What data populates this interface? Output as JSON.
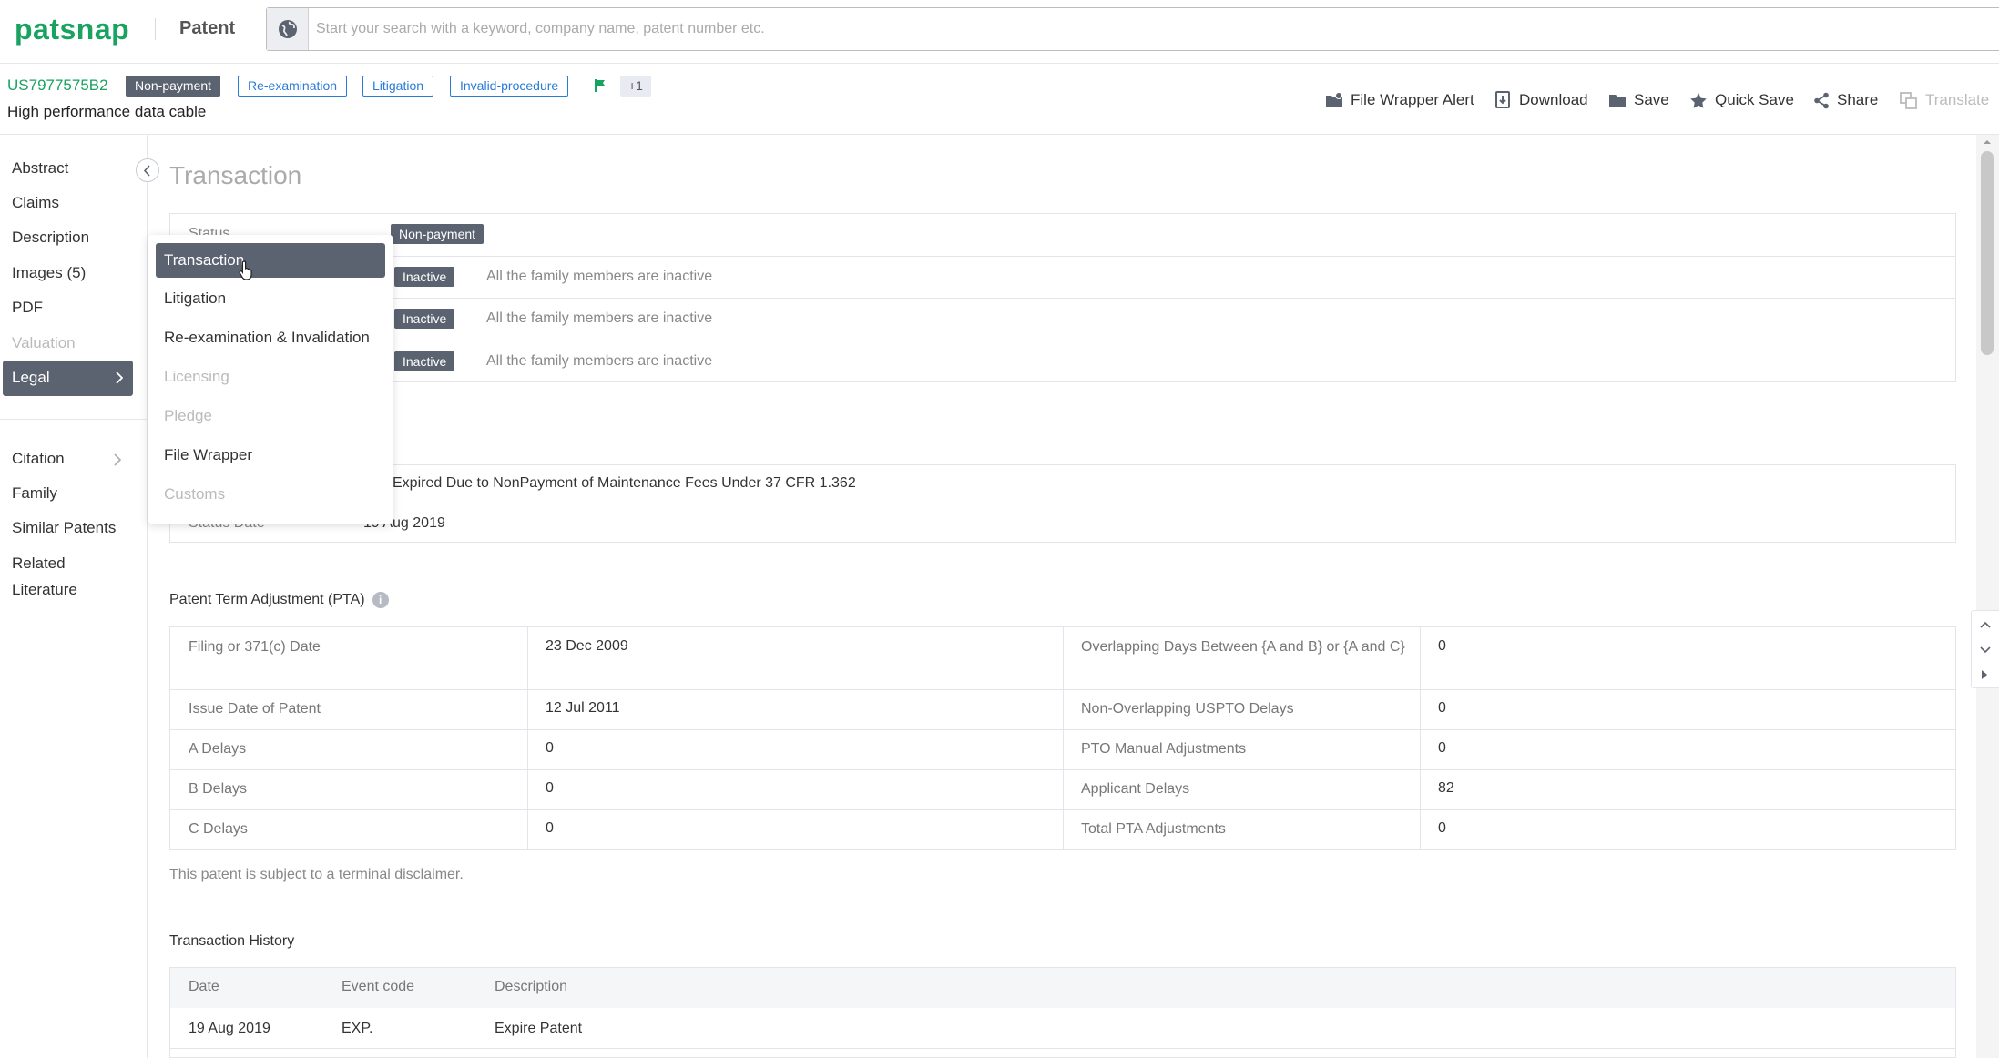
{
  "header": {
    "logo": "patsnap",
    "product": "Patent",
    "search_placeholder": "Start your search with a keyword, company name, patent number etc."
  },
  "patent": {
    "number": "US7977575B2",
    "title": "High performance data cable",
    "badges": [
      "Non-payment",
      "Re-examination",
      "Litigation",
      "Invalid-procedure"
    ],
    "more_count": "+1"
  },
  "actions": {
    "file_wrapper_alert": "File Wrapper Alert",
    "download": "Download",
    "save": "Save",
    "quick_save": "Quick Save",
    "share": "Share",
    "translate": "Translate"
  },
  "sidebar": {
    "items": [
      "Abstract",
      "Claims",
      "Description",
      "Images (5)",
      "PDF",
      "Valuation"
    ],
    "active": "Legal",
    "items2": [
      "Citation",
      "Family",
      "Similar Patents",
      "Related",
      "Literature"
    ]
  },
  "dropdown": {
    "items": [
      "Transaction",
      "Litigation",
      "Re-examination & Invalidation",
      "Licensing",
      "Pledge",
      "File Wrapper",
      "Customs"
    ]
  },
  "transaction": {
    "title": "Transaction",
    "status_label": "Status",
    "status_value": "Non-payment",
    "inactive_tag": "Inactive",
    "inactive_text": "All the family members are inactive",
    "uspto_status_text": "Expired Due to NonPayment of Maintenance Fees Under 37 CFR 1.362",
    "status_date_label": "Status Date",
    "status_date_value": "19 Aug 2019"
  },
  "pta": {
    "title": "Patent Term Adjustment (PTA)",
    "info": "i",
    "left": [
      {
        "label": "Filing or 371(c) Date",
        "value": "23 Dec 2009"
      },
      {
        "label": "Issue Date of Patent",
        "value": "12 Jul 2011"
      },
      {
        "label": "A Delays",
        "value": "0"
      },
      {
        "label": "B Delays",
        "value": "0"
      },
      {
        "label": "C Delays",
        "value": "0"
      }
    ],
    "right": [
      {
        "label": "Overlapping Days Between {A and B} or {A and C}",
        "value": "0"
      },
      {
        "label": "Non-Overlapping USPTO Delays",
        "value": "0"
      },
      {
        "label": "PTO Manual Adjustments",
        "value": "0"
      },
      {
        "label": "Applicant Delays",
        "value": "82"
      },
      {
        "label": "Total PTA Adjustments",
        "value": "0"
      }
    ],
    "note": "This patent is subject to a terminal disclaimer."
  },
  "history": {
    "title": "Transaction History",
    "columns": [
      "Date",
      "Event code",
      "Description"
    ],
    "rows": [
      {
        "date": "19 Aug 2019",
        "code": "EXP.",
        "description": "Expire Patent"
      }
    ]
  }
}
